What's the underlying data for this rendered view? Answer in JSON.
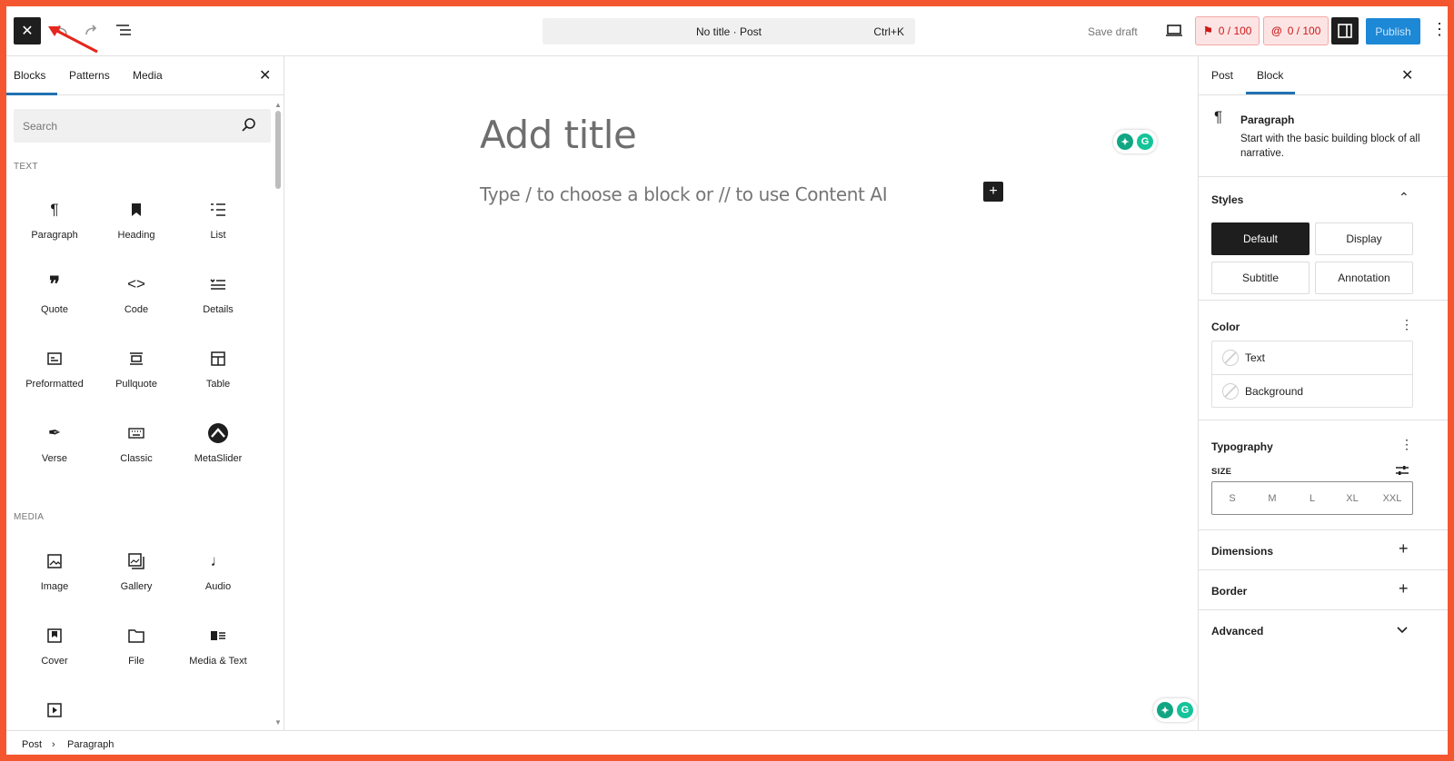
{
  "colors": {
    "accent": "#2271b1",
    "publish_bg": "#1c88d6",
    "frame": "#f4572f",
    "score": "#cc1818"
  },
  "topbar": {
    "close_icon": "close-icon",
    "undo_icon": "undo-icon",
    "redo_icon": "redo-icon",
    "list_view_icon": "list-view-icon",
    "command": "No title · Post",
    "command_shortcut": "Ctrl+K",
    "save_draft": "Save draft",
    "preview_icon": "desktop-icon",
    "seo_score": "0 / 100",
    "content_score": "0 / 100",
    "publish": "Publish"
  },
  "inserter": {
    "tabs": [
      "Blocks",
      "Patterns",
      "Media"
    ],
    "search_placeholder": "Search",
    "categories": {
      "text": "TEXT",
      "media": "MEDIA"
    },
    "text_blocks": [
      {
        "label": "Paragraph",
        "icon": "paragraph-icon"
      },
      {
        "label": "Heading",
        "icon": "heading-icon"
      },
      {
        "label": "List",
        "icon": "list-icon"
      },
      {
        "label": "Quote",
        "icon": "quote-icon"
      },
      {
        "label": "Code",
        "icon": "code-icon"
      },
      {
        "label": "Details",
        "icon": "details-icon"
      },
      {
        "label": "Preformatted",
        "icon": "preformatted-icon"
      },
      {
        "label": "Pullquote",
        "icon": "pullquote-icon"
      },
      {
        "label": "Table",
        "icon": "table-icon"
      },
      {
        "label": "Verse",
        "icon": "verse-icon"
      },
      {
        "label": "Classic",
        "icon": "classic-icon"
      },
      {
        "label": "MetaSlider",
        "icon": "metaslider-icon"
      }
    ],
    "media_blocks": [
      {
        "label": "Image",
        "icon": "image-icon"
      },
      {
        "label": "Gallery",
        "icon": "gallery-icon"
      },
      {
        "label": "Audio",
        "icon": "audio-icon"
      },
      {
        "label": "Cover",
        "icon": "cover-icon"
      },
      {
        "label": "File",
        "icon": "file-icon"
      },
      {
        "label": "Media & Text",
        "icon": "media-text-icon"
      },
      {
        "label": "",
        "icon": "video-icon"
      }
    ]
  },
  "canvas": {
    "title_placeholder": "Add title",
    "paragraph_placeholder": "Type / to choose a block or // to use Content AI"
  },
  "settings": {
    "tabs": [
      "Post",
      "Block"
    ],
    "block_name": "Paragraph",
    "block_desc": "Start with the basic building block of all narrative.",
    "styles": {
      "title": "Styles",
      "options": [
        "Default",
        "Display",
        "Subtitle",
        "Annotation"
      ]
    },
    "color": {
      "title": "Color",
      "items": [
        "Text",
        "Background"
      ]
    },
    "typography": {
      "title": "Typography",
      "size_label": "SIZE",
      "sizes": [
        "S",
        "M",
        "L",
        "XL",
        "XXL"
      ]
    },
    "dimensions": "Dimensions",
    "border": "Border",
    "advanced": "Advanced"
  },
  "footer": {
    "crumbs": [
      "Post",
      "Paragraph"
    ]
  }
}
